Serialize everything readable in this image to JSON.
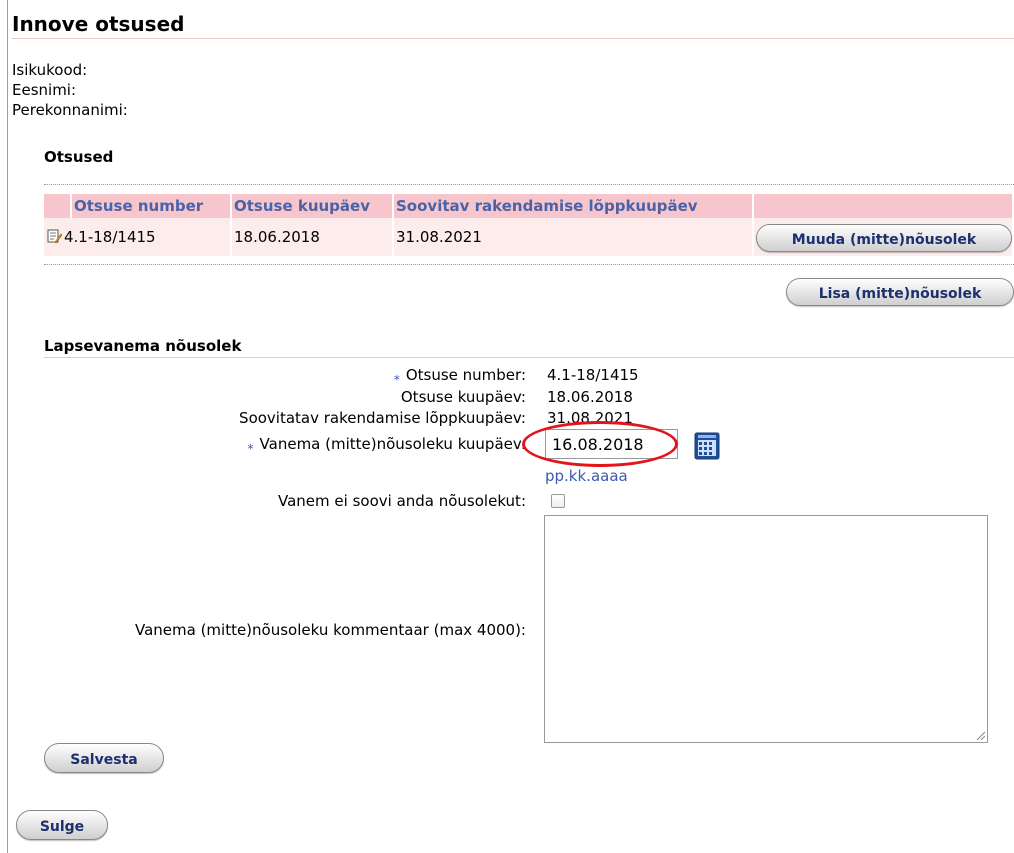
{
  "page": {
    "title": "Innove otsused"
  },
  "person": {
    "id_code_label": "Isikukood:",
    "first_name_label": "Eesnimi:",
    "last_name_label": "Perekonnanimi:"
  },
  "decisions": {
    "section_title": "Otsused",
    "columns": [
      "Otsuse number",
      "Otsuse kuupäev",
      "Soovitav rakendamise lõppkuupäev",
      ""
    ],
    "rows": [
      {
        "number": "4.1-18/1415",
        "date": "18.06.2018",
        "end_date": "31.08.2021",
        "action_label": "Muuda (mitte)nõusolek"
      }
    ],
    "add_button": "Lisa (mitte)nõusolek"
  },
  "consent": {
    "section_title": "Lapsevanema nõusolek",
    "required_marker": "⁎",
    "decision_number_label": "Otsuse number:",
    "decision_number": "4.1-18/1415",
    "decision_date_label": "Otsuse kuupäev:",
    "decision_date": "18.06.2018",
    "end_date_label": "Soovitatav rakendamise lõppkuupäev:",
    "end_date": "31.08.2021",
    "consent_date_label": "Vanema (mitte)nõusoleku kuupäev:",
    "consent_date": "16.08.2018",
    "date_format_hint": "pp.kk.aaaa",
    "refuse_label": "Vanem ei soovi anda nõusolekut:",
    "refuse_checked": false,
    "comment_label": "Vanema (mitte)nõusoleku kommentaar (max 4000):",
    "comment_value": "",
    "save_button": "Salvesta"
  },
  "close_button": "Sulge",
  "colors": {
    "header_bg": "#f7c6cc",
    "header_text": "#4a62a8",
    "row_bg": "#fdecec",
    "annotation_red": "#e4141d"
  },
  "icons": [
    "edit-icon",
    "calendar-icon",
    "resize-grip-icon"
  ]
}
